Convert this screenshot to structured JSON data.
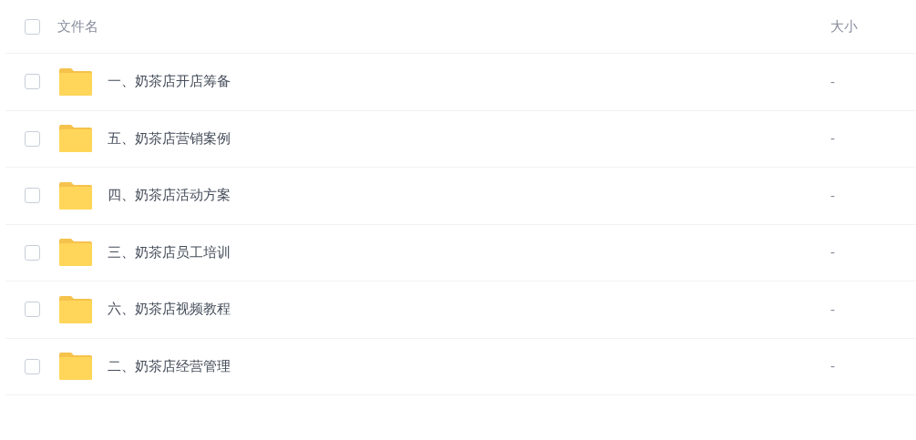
{
  "header": {
    "checked": false,
    "name_label": "文件名",
    "size_label": "大小"
  },
  "files": [
    {
      "name": "一、奶茶店开店筹备",
      "size": "-",
      "checked": false,
      "kind": "folder"
    },
    {
      "name": "五、奶茶店营销案例",
      "size": "-",
      "checked": false,
      "kind": "folder"
    },
    {
      "name": "四、奶茶店活动方案",
      "size": "-",
      "checked": false,
      "kind": "folder"
    },
    {
      "name": "三、奶茶店员工培训",
      "size": "-",
      "checked": false,
      "kind": "folder"
    },
    {
      "name": "六、奶茶店视频教程",
      "size": "-",
      "checked": false,
      "kind": "folder"
    },
    {
      "name": "二、奶茶店经营管理",
      "size": "-",
      "checked": false,
      "kind": "folder"
    }
  ]
}
